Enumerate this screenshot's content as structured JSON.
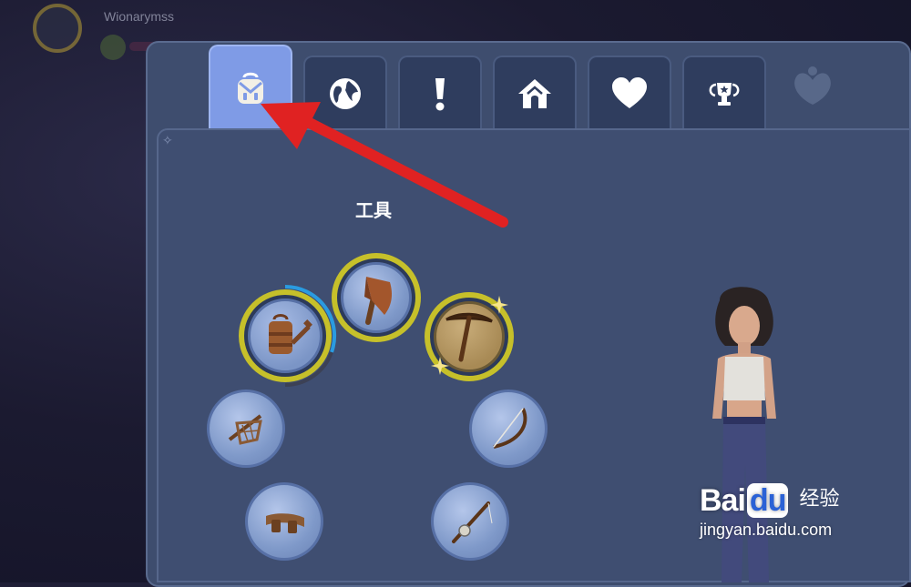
{
  "player": {
    "name": "Wionarymss"
  },
  "tabs": [
    {
      "icon": "backpack-icon",
      "active": true
    },
    {
      "icon": "globe-icon",
      "active": false
    },
    {
      "icon": "exclamation-icon",
      "active": false
    },
    {
      "icon": "house-icon",
      "active": false
    },
    {
      "icon": "heart-icon",
      "active": false
    },
    {
      "icon": "trophy-icon",
      "active": false
    }
  ],
  "section": {
    "title": "工具"
  },
  "tools": [
    {
      "icon": "watering-can-icon",
      "equipped": true,
      "durability": 0.65
    },
    {
      "icon": "axe-icon",
      "equipped": true
    },
    {
      "icon": "pickaxe-icon",
      "equipped": true,
      "selected": true
    },
    {
      "icon": "net-icon",
      "equipped": false
    },
    {
      "icon": "bow-icon",
      "equipped": false
    },
    {
      "icon": "belt-icon",
      "equipped": false
    },
    {
      "icon": "fishing-rod-icon",
      "equipped": false
    }
  ],
  "watermark": {
    "logo_left": "Bai",
    "logo_du": "du",
    "logo_right": "经验",
    "url": "jingyan.baidu.com"
  },
  "colors": {
    "accent": "#7f9be6",
    "equip_ring": "#c6c02a",
    "arrow": "#e02222"
  }
}
